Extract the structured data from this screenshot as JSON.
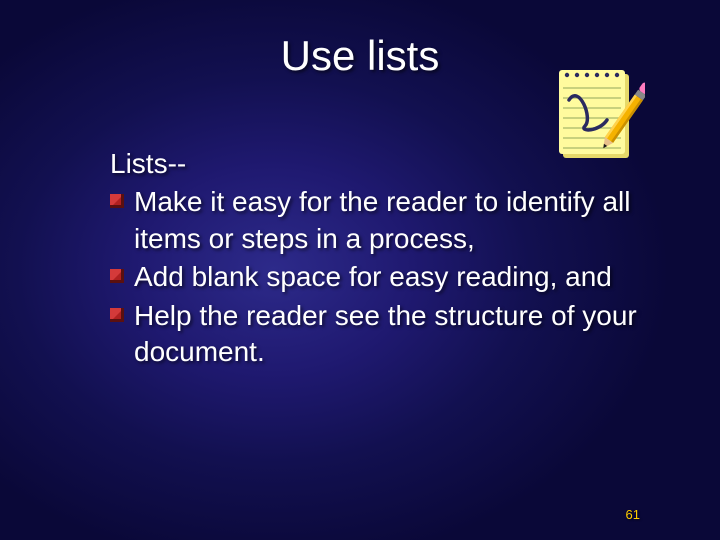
{
  "title": "Use lists",
  "intro": "Lists--",
  "bullets": {
    "b1": "Make it easy for the reader to identify all items or steps in a process,",
    "b2": "Add blank space for easy reading, and",
    "b3": "Help the reader see the structure of your document."
  },
  "page_number": "61",
  "colors": {
    "accent": "#ffcc00",
    "bullet_red": "#b02020",
    "bullet_dark": "#5a1010",
    "notepad_paper": "#fffb9e",
    "notepad_line": "#a8b86a",
    "notepad_back": "#e6d96a",
    "pencil_body": "#f5b200",
    "pencil_eraser": "#ff7bbf",
    "pencil_ferrule": "#888888",
    "pencil_tip_wood": "#e8c08a",
    "scribble": "#2a2a60"
  }
}
